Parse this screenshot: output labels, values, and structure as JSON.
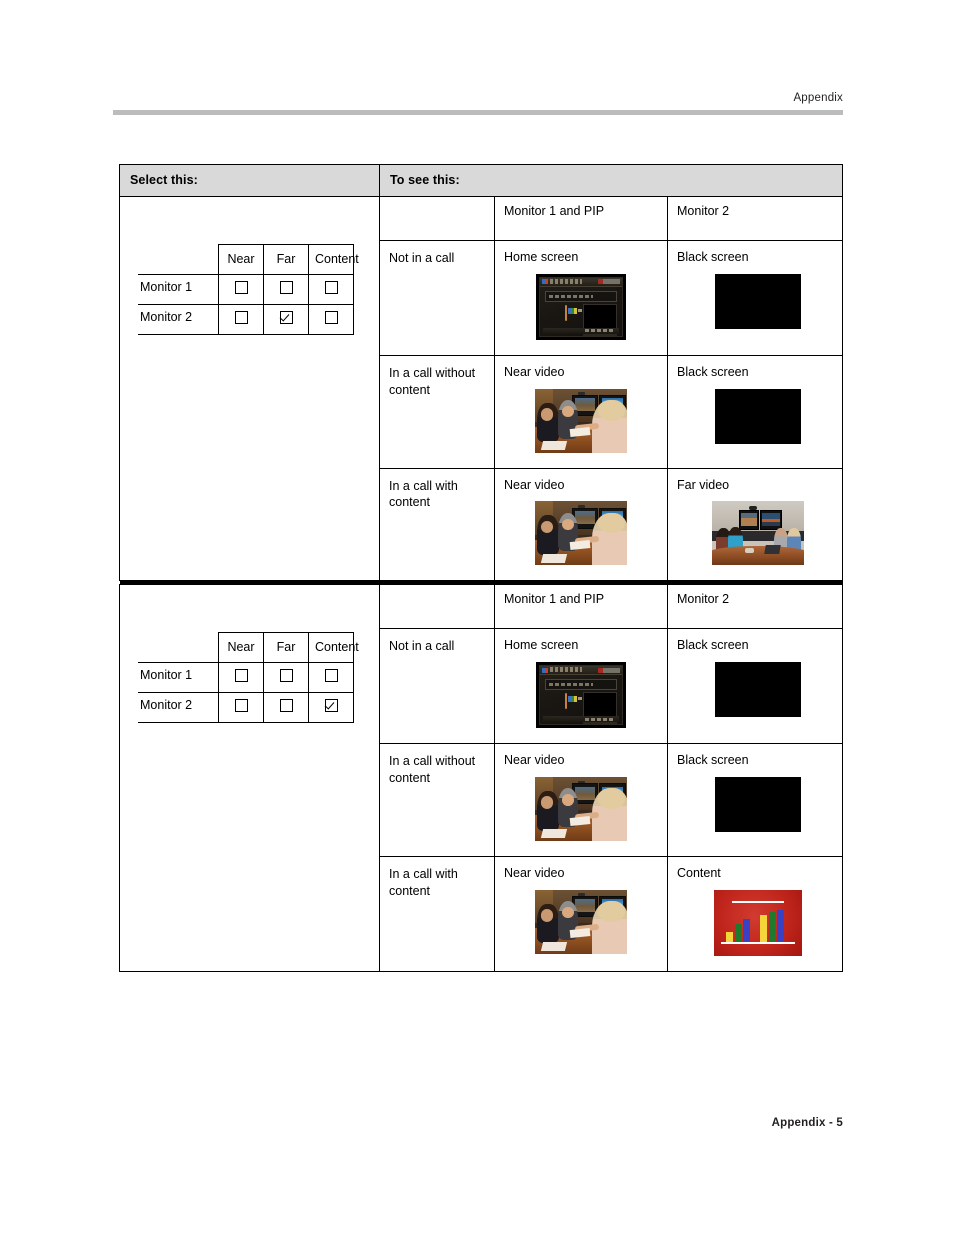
{
  "page": {
    "header_text": "Appendix",
    "footer_text": "Appendix - 5"
  },
  "table": {
    "header": {
      "select_this": "Select this:",
      "to_see_this": "To see this:"
    },
    "column_headers": {
      "blank": "",
      "monitor1_pip": "Monitor 1 and PIP",
      "monitor2": "Monitor 2"
    },
    "sections": [
      {
        "id": "section-1",
        "select_table": {
          "corner": "",
          "columns": [
            "Near",
            "Far",
            "Content"
          ],
          "rows": [
            {
              "label": "Monitor 1",
              "checked": [
                false,
                false,
                false
              ]
            },
            {
              "label": "Monitor 2",
              "checked": [
                false,
                true,
                false
              ]
            }
          ]
        },
        "rows": [
          {
            "state": "Not in a call",
            "monitor1": {
              "label": "Home screen",
              "thumb": "home-screen"
            },
            "monitor2": {
              "label": "Black screen",
              "thumb": "black-screen"
            }
          },
          {
            "state": "In a call without content",
            "monitor1": {
              "label": "Near video",
              "thumb": "near-video"
            },
            "monitor2": {
              "label": "Black screen",
              "thumb": "black-screen"
            }
          },
          {
            "state": "In a call with content",
            "monitor1": {
              "label": "Near video",
              "thumb": "near-video"
            },
            "monitor2": {
              "label": "Far video",
              "thumb": "far-video"
            }
          }
        ]
      },
      {
        "id": "section-2",
        "select_table": {
          "corner": "",
          "columns": [
            "Near",
            "Far",
            "Content"
          ],
          "rows": [
            {
              "label": "Monitor 1",
              "checked": [
                false,
                false,
                false
              ]
            },
            {
              "label": "Monitor 2",
              "checked": [
                false,
                false,
                true
              ]
            }
          ]
        },
        "rows": [
          {
            "state": "Not in a call",
            "monitor1": {
              "label": "Home screen",
              "thumb": "home-screen"
            },
            "monitor2": {
              "label": "Black screen",
              "thumb": "black-screen"
            }
          },
          {
            "state": "In a call without content",
            "monitor1": {
              "label": "Near video",
              "thumb": "near-video"
            },
            "monitor2": {
              "label": "Black screen",
              "thumb": "black-screen"
            }
          },
          {
            "state": "In a call with content",
            "monitor1": {
              "label": "Near video",
              "thumb": "near-video"
            },
            "monitor2": {
              "label": "Content",
              "thumb": "content-chart"
            }
          }
        ]
      }
    ]
  },
  "thumbnails": {
    "home_screen": {
      "title": "Place a Call",
      "menu_items": [
        "Directory",
        "Recent Calls"
      ]
    },
    "content_chart": {
      "background_color": "#c0251c",
      "bar_colors": [
        "#f5d53a",
        "#1f7a2e",
        "#3942c4"
      ],
      "bar_heights_pct": [
        30,
        52,
        66,
        78,
        88,
        92
      ]
    }
  },
  "colors": {
    "header_band": "#d9d9d9",
    "rule": "#bcbcbc",
    "border": "#000000"
  }
}
